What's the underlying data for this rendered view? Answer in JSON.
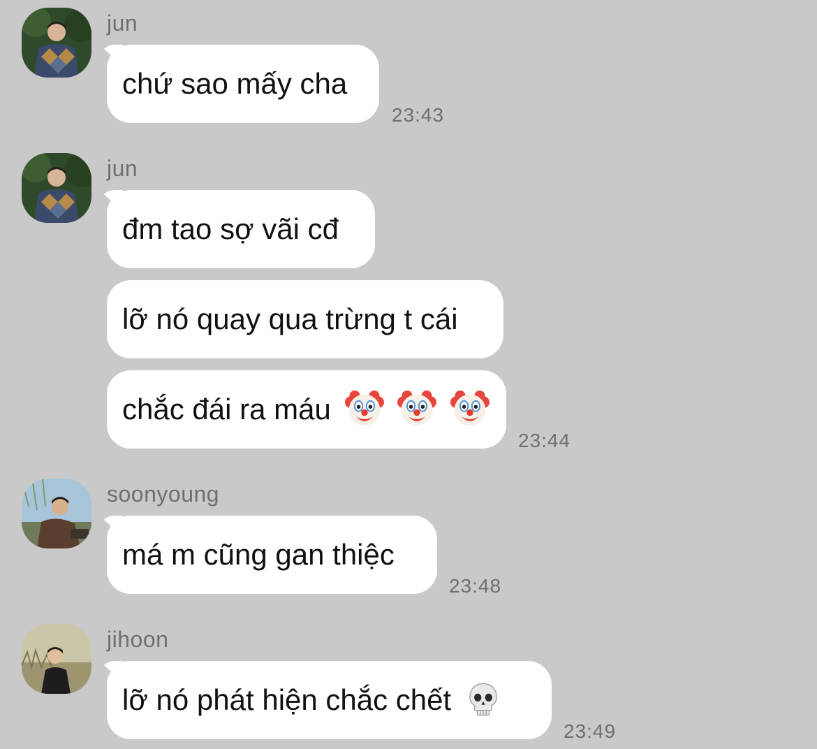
{
  "chat": {
    "groups": [
      {
        "sender": "jun",
        "avatar_icon": "avatar-jun-photo",
        "messages": [
          {
            "text": "chứ sao mấy cha",
            "emojis": []
          }
        ],
        "time": "23:43"
      },
      {
        "sender": "jun",
        "avatar_icon": "avatar-jun-photo",
        "messages": [
          {
            "text": "đm tao sợ vãi cđ",
            "emojis": []
          },
          {
            "text": "lỡ nó quay qua trừng t cái",
            "emojis": []
          },
          {
            "text": "chắc đái ra máu",
            "emojis": [
              "clown-face-emoji",
              "clown-face-emoji",
              "clown-face-emoji"
            ]
          }
        ],
        "time": "23:44"
      },
      {
        "sender": "soonyoung",
        "avatar_icon": "avatar-soonyoung-photo",
        "messages": [
          {
            "text": "má m cũng gan thiệc",
            "emojis": []
          }
        ],
        "time": "23:48"
      },
      {
        "sender": "jihoon",
        "avatar_icon": "avatar-jihoon-photo",
        "messages": [
          {
            "text": "lỡ nó phát hiện chắc chết",
            "emojis": [
              "skull-emoji"
            ]
          }
        ],
        "time": "23:49"
      }
    ]
  },
  "colors": {
    "background": "#c9c9c9",
    "bubble": "#ffffff",
    "meta_text": "#6f6f6f",
    "message_text": "#111111"
  }
}
